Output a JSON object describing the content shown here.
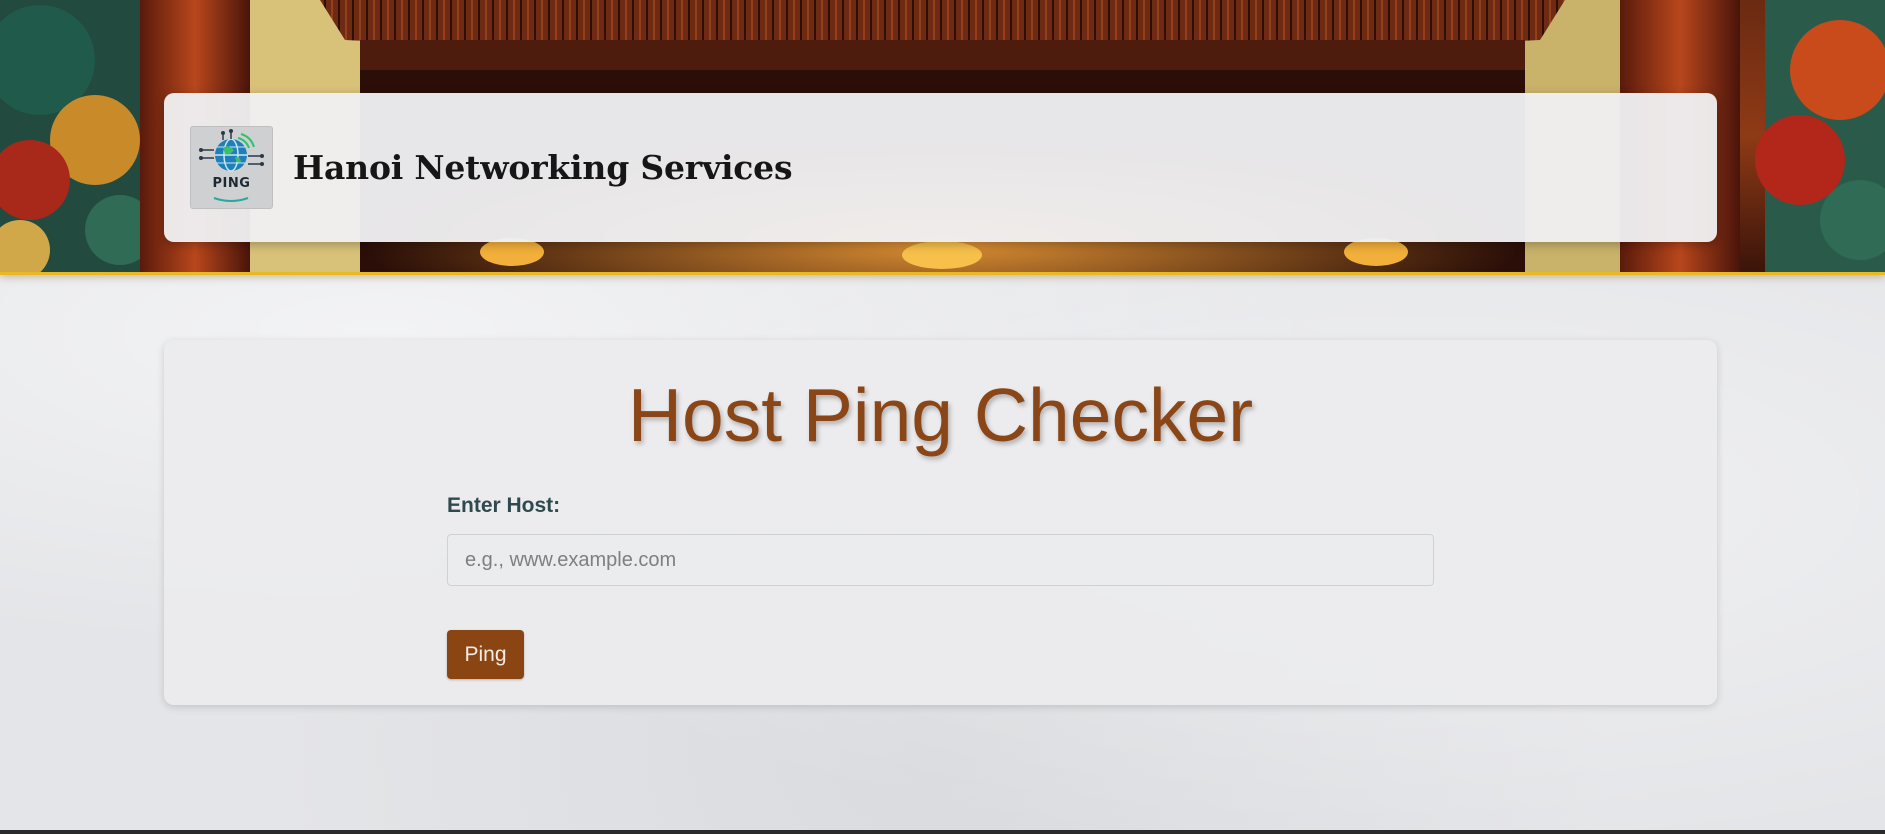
{
  "header": {
    "brand_title": "Hanoi Networking Services",
    "logo_text": "PING",
    "logo_icon": "globe-network-icon"
  },
  "banner": {
    "image": "pagoda-gate-illustration",
    "accent_color": "#e8b923"
  },
  "main": {
    "title": "Host Ping Checker",
    "host_label": "Enter Host:",
    "host_input": {
      "value": "",
      "placeholder": "e.g., www.example.com"
    },
    "ping_button_label": "Ping"
  },
  "colors": {
    "title": "#8a4616",
    "button_bg": "#8b4513",
    "label": "#2f4a4f",
    "page_bg": "#e4e5e8"
  }
}
